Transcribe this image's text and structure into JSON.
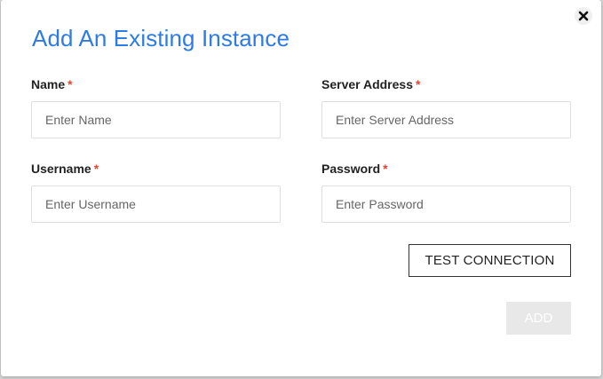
{
  "dialog": {
    "title": "Add An Existing Instance",
    "close_icon": "close-icon",
    "required_marker": "*",
    "required_color": "#e0442e",
    "accent_color": "#2f7be5"
  },
  "fields": {
    "name": {
      "label": "Name",
      "placeholder": "Enter Name",
      "value": ""
    },
    "server_address": {
      "label": "Server Address",
      "placeholder": "Enter Server Address",
      "value": ""
    },
    "username": {
      "label": "Username",
      "placeholder": "Enter Username",
      "value": ""
    },
    "password": {
      "label": "Password",
      "placeholder": "Enter Password",
      "value": ""
    }
  },
  "actions": {
    "test_connection_label": "TEST CONNECTION",
    "add_label": "ADD",
    "add_disabled": true
  }
}
